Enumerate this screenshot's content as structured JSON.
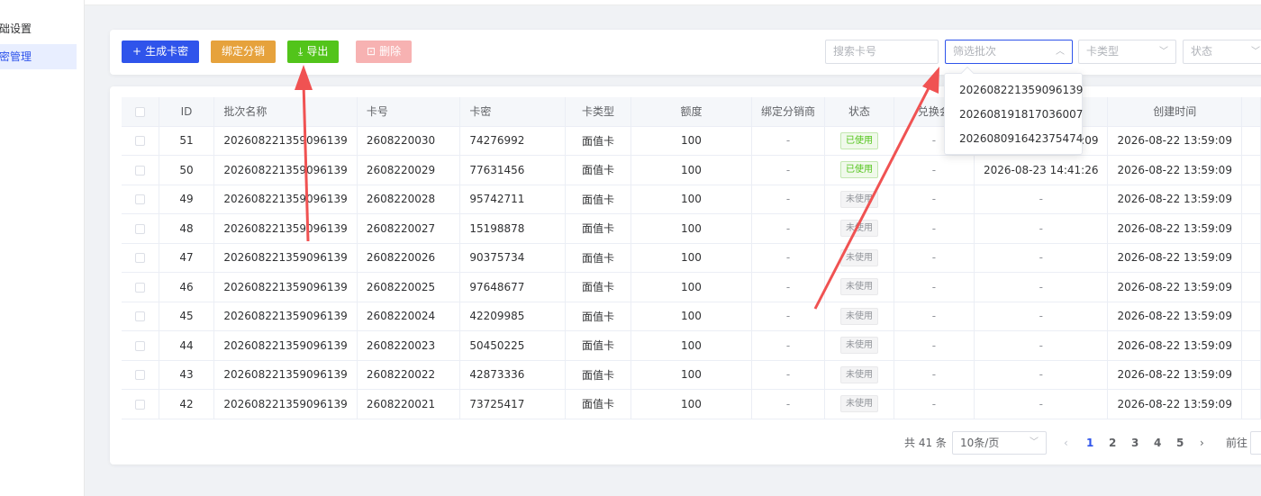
{
  "sidebar": {
    "items": [
      {
        "label": "础设置",
        "active": false
      },
      {
        "label": "密管理",
        "active": true
      }
    ]
  },
  "toolbar": {
    "generate_label": "生成卡密",
    "bind_label": "绑定分销",
    "export_label": "导出",
    "delete_label": "删除",
    "search_placeholder": "搜索卡号",
    "batch_placeholder": "筛选批次",
    "card_type_placeholder": "卡类型",
    "status_placeholder": "状态"
  },
  "batch_dropdown": {
    "options": [
      "202608221359096139",
      "202608191817036007",
      "202608091642375474"
    ]
  },
  "table": {
    "headers": [
      "ID",
      "批次名称",
      "卡号",
      "卡密",
      "卡类型",
      "额度",
      "绑定分销商",
      "状态",
      "兑换会",
      "",
      "创建时间"
    ],
    "rows": [
      {
        "id": "51",
        "batch": "202608221359096139",
        "card_no": "2608220030",
        "secret": "74276992",
        "type": "面值卡",
        "amount": "100",
        "dist": "-",
        "status": "已使用",
        "member": "-",
        "redeem_time": "2026-08-22 13:59:09",
        "created": "2026-08-22 13:59:09"
      },
      {
        "id": "50",
        "batch": "202608221359096139",
        "card_no": "2608220029",
        "secret": "77631456",
        "type": "面值卡",
        "amount": "100",
        "dist": "-",
        "status": "已使用",
        "member": "-",
        "redeem_time": "2026-08-23 14:41:26",
        "created": "2026-08-22 13:59:09"
      },
      {
        "id": "49",
        "batch": "202608221359096139",
        "card_no": "2608220028",
        "secret": "95742711",
        "type": "面值卡",
        "amount": "100",
        "dist": "-",
        "status": "未使用",
        "member": "-",
        "redeem_time": "-",
        "created": "2026-08-22 13:59:09"
      },
      {
        "id": "48",
        "batch": "202608221359096139",
        "card_no": "2608220027",
        "secret": "15198878",
        "type": "面值卡",
        "amount": "100",
        "dist": "-",
        "status": "未使用",
        "member": "-",
        "redeem_time": "-",
        "created": "2026-08-22 13:59:09"
      },
      {
        "id": "47",
        "batch": "202608221359096139",
        "card_no": "2608220026",
        "secret": "90375734",
        "type": "面值卡",
        "amount": "100",
        "dist": "-",
        "status": "未使用",
        "member": "-",
        "redeem_time": "-",
        "created": "2026-08-22 13:59:09"
      },
      {
        "id": "46",
        "batch": "202608221359096139",
        "card_no": "2608220025",
        "secret": "97648677",
        "type": "面值卡",
        "amount": "100",
        "dist": "-",
        "status": "未使用",
        "member": "-",
        "redeem_time": "-",
        "created": "2026-08-22 13:59:09"
      },
      {
        "id": "45",
        "batch": "202608221359096139",
        "card_no": "2608220024",
        "secret": "42209985",
        "type": "面值卡",
        "amount": "100",
        "dist": "-",
        "status": "未使用",
        "member": "-",
        "redeem_time": "-",
        "created": "2026-08-22 13:59:09"
      },
      {
        "id": "44",
        "batch": "202608221359096139",
        "card_no": "2608220023",
        "secret": "50450225",
        "type": "面值卡",
        "amount": "100",
        "dist": "-",
        "status": "未使用",
        "member": "-",
        "redeem_time": "-",
        "created": "2026-08-22 13:59:09"
      },
      {
        "id": "43",
        "batch": "202608221359096139",
        "card_no": "2608220022",
        "secret": "42873336",
        "type": "面值卡",
        "amount": "100",
        "dist": "-",
        "status": "未使用",
        "member": "-",
        "redeem_time": "-",
        "created": "2026-08-22 13:59:09"
      },
      {
        "id": "42",
        "batch": "202608221359096139",
        "card_no": "2608220021",
        "secret": "73725417",
        "type": "面值卡",
        "amount": "100",
        "dist": "-",
        "status": "未使用",
        "member": "-",
        "redeem_time": "-",
        "created": "2026-08-22 13:59:09"
      }
    ]
  },
  "pagination": {
    "total": "共 41 条",
    "page_size": "10条/页",
    "pages": [
      "1",
      "2",
      "3",
      "4",
      "5"
    ],
    "current": "1",
    "prev": "‹",
    "next": "›",
    "goto_label": "前往"
  },
  "colors": {
    "primary": "#2f54eb",
    "warning": "#e6a23c",
    "success": "#52c41a",
    "danger_light": "#f7b2b2",
    "annotation": "#f05252"
  }
}
